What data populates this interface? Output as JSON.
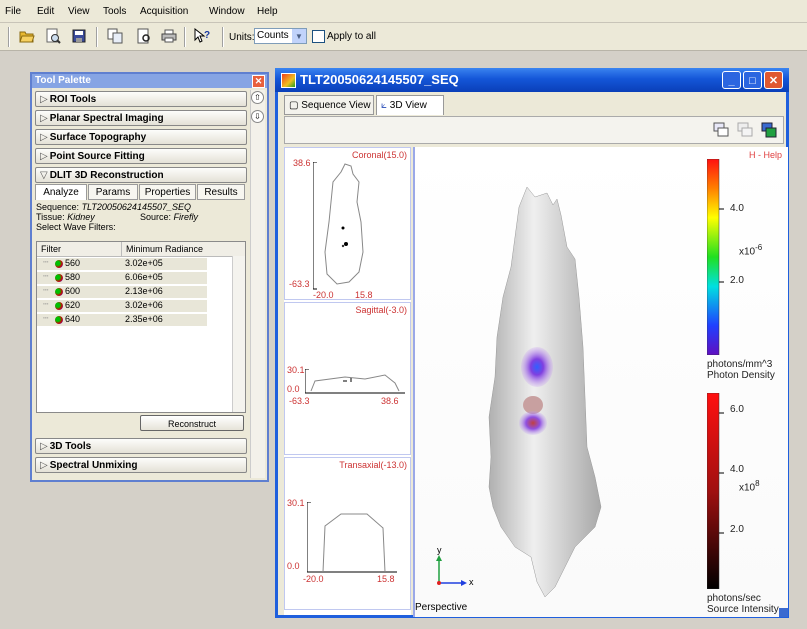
{
  "menu": [
    "File",
    "Edit",
    "View",
    "Tools",
    "Acquisition",
    "Window",
    "Help"
  ],
  "toolbar": {
    "icons": [
      "open-folder-icon",
      "find-icon",
      "save-icon",
      "copy-icon",
      "print-preview-icon",
      "print-icon",
      "help-pointer-icon"
    ],
    "units_label": "Units:",
    "units_value": "Counts",
    "apply_label": "Apply to all",
    "apply_checked": false
  },
  "palette": {
    "title": "Tool Palette",
    "sections_top": [
      "ROI Tools",
      "Planar Spectral Imaging",
      "Surface Topography",
      "Point Source Fitting"
    ],
    "dlit_title": "DLIT 3D Reconstruction",
    "tabs": [
      "Analyze",
      "Params",
      "Properties",
      "Results"
    ],
    "sequence_label": "Sequence:",
    "sequence_value": "TLT20050624145507_SEQ",
    "tissue_label": "Tissue:",
    "tissue_value": "Kidney",
    "source_label": "Source:",
    "source_value": "Firefly",
    "filters_label": "Select Wave Filters:",
    "table_headers": [
      "Filter",
      "Minimum Radiance"
    ],
    "filters": [
      {
        "filter": "560",
        "radiance": "3.02e+05"
      },
      {
        "filter": "580",
        "radiance": "6.06e+05"
      },
      {
        "filter": "600",
        "radiance": "2.13e+06"
      },
      {
        "filter": "620",
        "radiance": "3.02e+06"
      },
      {
        "filter": "640",
        "radiance": "2.35e+06"
      }
    ],
    "reconstruct_label": "Reconstruct",
    "sections_bottom": [
      "3D Tools",
      "Spectral Unmixing"
    ]
  },
  "window": {
    "title": "TLT20050624145507_SEQ",
    "tabs": [
      "Sequence View",
      "3D View"
    ],
    "active_tab": "3D View"
  },
  "slices": [
    {
      "title": "Coronal(15.0)",
      "y_top": "38.6",
      "y_bottom": "-63.3",
      "x_left": "-20.0",
      "x_right": "15.8"
    },
    {
      "title": "Sagittal(-3.0)",
      "y_top": "30.1",
      "y_bottom": "0.0",
      "x_left": "-63.3",
      "x_right": "38.6"
    },
    {
      "title": "Transaxial(-13.0)",
      "y_top": "30.1",
      "y_bottom": "0.0",
      "x_left": "-20.0",
      "x_right": "15.8"
    }
  ],
  "view3d": {
    "help": "H - Help",
    "perspective": "Perspective",
    "axis_y": "y",
    "axis_x": "x",
    "density_scale": {
      "ticks": [
        "4.0",
        "2.0"
      ],
      "multiplier": "x10",
      "exponent": "-6",
      "unit_line1": "photons/mm^3",
      "unit_line2": "Photon Density"
    },
    "intensity_scale": {
      "ticks": [
        "6.0",
        "4.0",
        "2.0"
      ],
      "multiplier": "x10",
      "exponent": "8",
      "unit_line1": "photons/sec",
      "unit_line2": "Source Intensity"
    }
  }
}
